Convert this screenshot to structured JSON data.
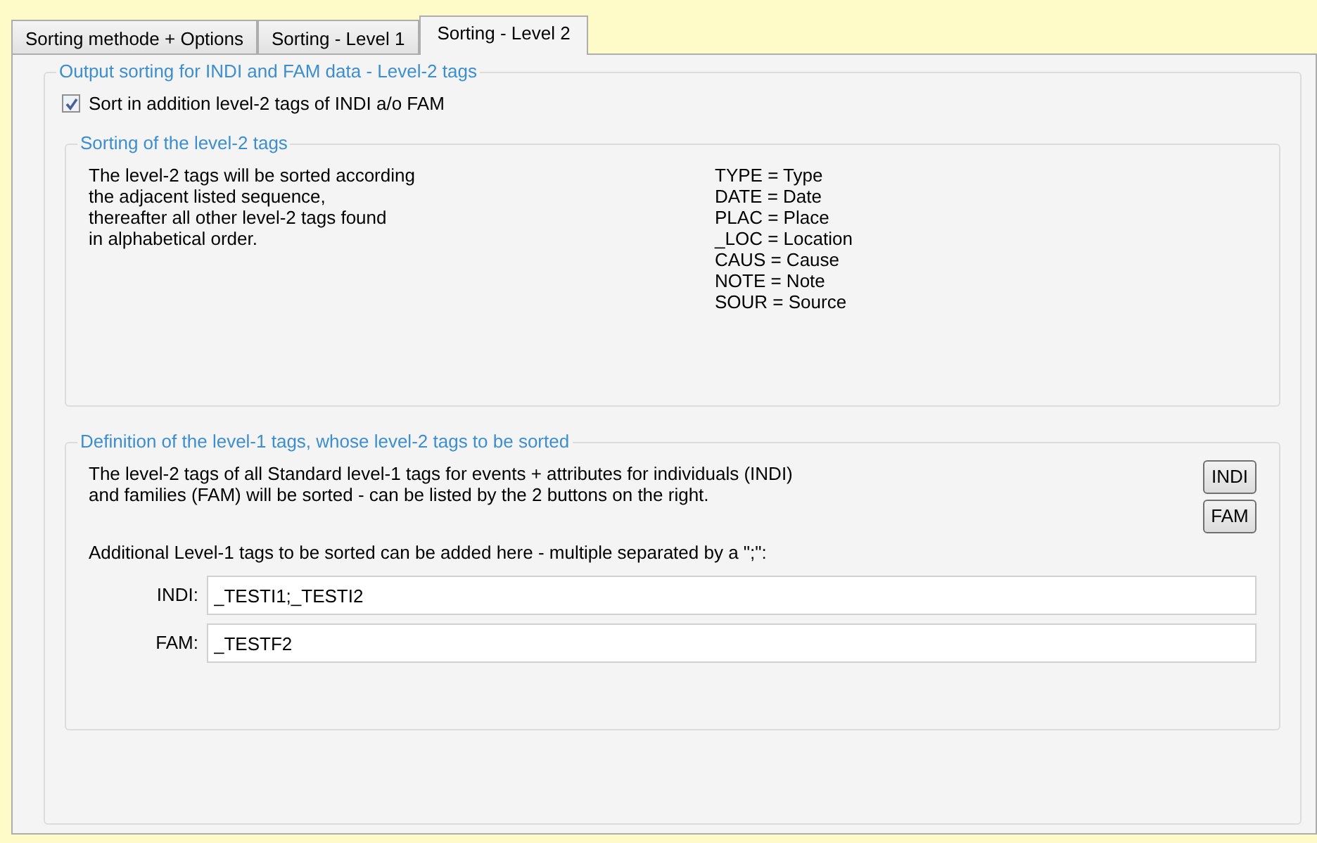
{
  "tabs": [
    {
      "label": "Sorting methode + Options",
      "selected": false
    },
    {
      "label": "Sorting - Level 1",
      "selected": false
    },
    {
      "label": "Sorting - Level 2",
      "selected": true
    }
  ],
  "group": {
    "title": "Output sorting for INDI and FAM data - Level-2 tags",
    "checkbox": {
      "label": "Sort in addition level-2 tags of INDI a/o FAM",
      "checked": true
    },
    "sorting": {
      "title": "Sorting of the level-2 tags",
      "description": [
        "The level-2 tags will be sorted according",
        "the adjacent listed sequence,",
        "thereafter all other level-2 tags found",
        "in alphabetical order."
      ],
      "tags": [
        "TYPE = Type",
        "DATE = Date",
        "PLAC = Place",
        "_LOC = Location",
        "CAUS = Cause",
        "NOTE = Note",
        "SOUR = Source"
      ]
    },
    "definition": {
      "title": "Definition of the level-1 tags, whose level-2 tags to be sorted",
      "description": [
        "The level-2 tags of all Standard level-1 tags for events + attributes for individuals (INDI)",
        "and families (FAM) will be sorted - can be listed by the 2 buttons on the right."
      ],
      "buttons": [
        "INDI",
        "FAM"
      ],
      "hint": "Additional Level-1 tags to be sorted can be added here - multiple separated by a \";\":",
      "fields": [
        {
          "label": "INDI:",
          "value": "_TESTI1;_TESTI2"
        },
        {
          "label": "FAM:",
          "value": "_TESTF2"
        }
      ]
    }
  }
}
